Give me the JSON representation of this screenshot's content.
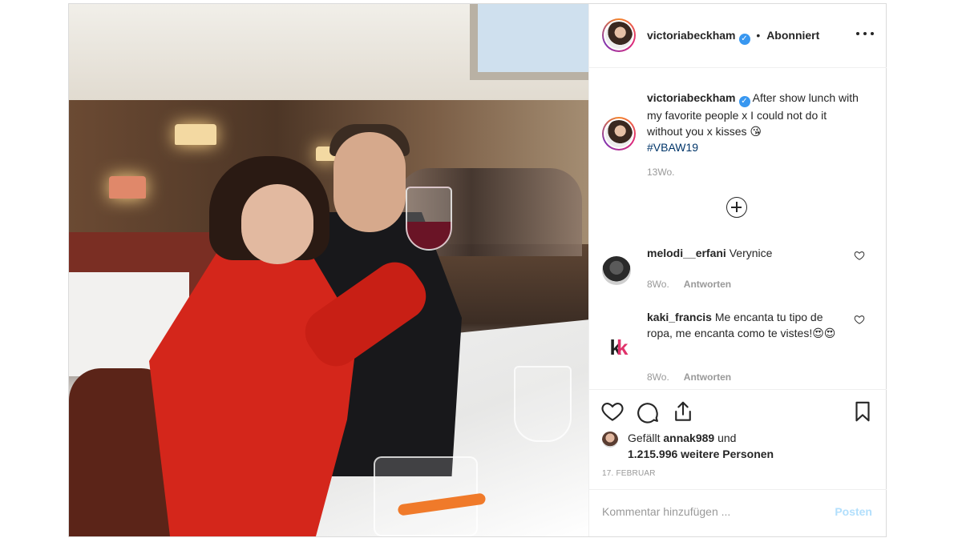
{
  "post": {
    "username": "victoriabeckham",
    "verified_mark": "✓",
    "separator": "•",
    "follow_status": "Abonniert",
    "more_icon": "more-horizontal-icon"
  },
  "caption": {
    "username": "victoriabeckham",
    "text": "After show lunch with my favorite people x I could not do it without you x kisses 😘",
    "hashtag": "#VBAW19",
    "time": "13Wo."
  },
  "load_more_icon": "plus-circle-icon",
  "comments": [
    {
      "username": "melodi__erfani",
      "text": "Verynice",
      "time": "8Wo.",
      "reply_label": "Antworten",
      "icon": "heart-outline-icon"
    },
    {
      "username": "kaki_francis",
      "text": "Me encanta tu tipo de ropa, me encanta como te vistes!😍😍",
      "time": "8Wo.",
      "reply_label": "Antworten",
      "icon": "heart-outline-icon",
      "avatar_text": "k",
      "avatar_text2": "k"
    }
  ],
  "actions": {
    "like_icon": "heart-icon",
    "comment_icon": "comment-icon",
    "share_icon": "share-icon",
    "save_icon": "bookmark-icon"
  },
  "likes": {
    "prefix": "Gefällt",
    "user": "annak989",
    "conjunction": "und",
    "count_text": "1.215.996 weitere Personen"
  },
  "date": "17. FEBRUAR",
  "add_comment": {
    "placeholder": "Kommentar hinzufügen ...",
    "post_label": "Posten"
  },
  "colors": {
    "verified": "#3897f0",
    "hashtag": "#003569",
    "post_button_disabled": "#b2dffc",
    "muted_text": "#999999",
    "dress_red": "#d4261b"
  }
}
